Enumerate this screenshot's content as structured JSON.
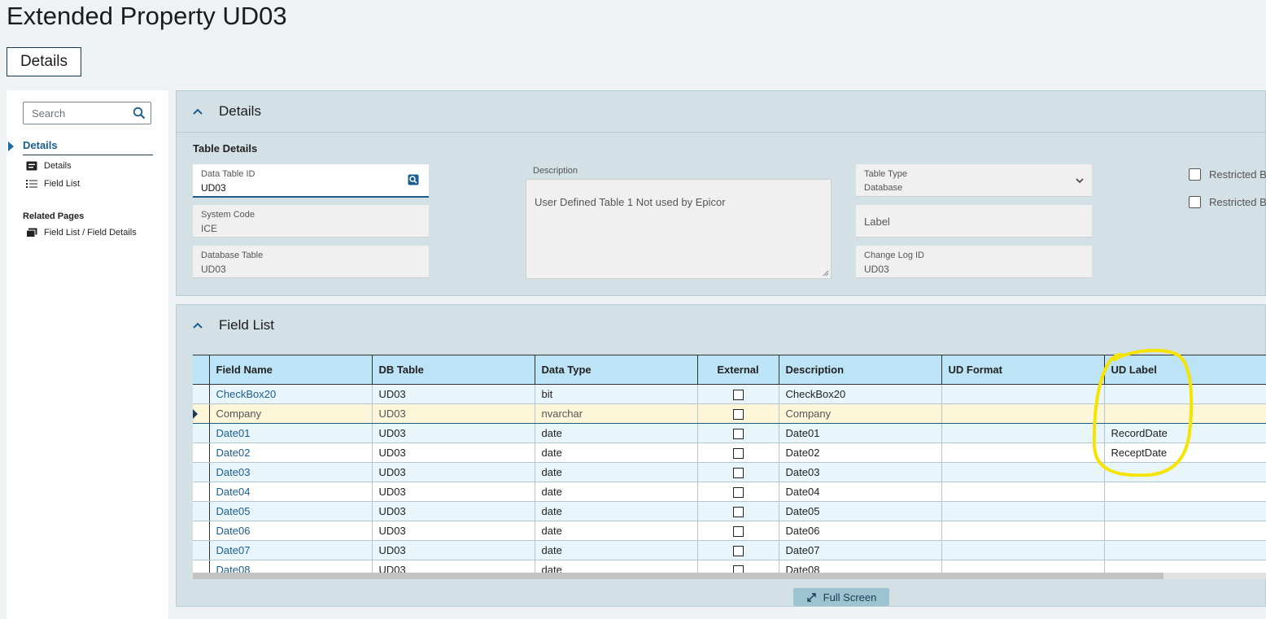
{
  "page": {
    "title": "Extended Property UD03"
  },
  "tabs": {
    "details": "Details"
  },
  "sidebar": {
    "search_placeholder": "Search",
    "nav_head": "Details",
    "items": [
      {
        "label": "Details",
        "icon": "details-card-icon"
      },
      {
        "label": "Field List",
        "icon": "list-icon"
      }
    ],
    "related_head": "Related Pages",
    "related_items": [
      {
        "label": "Field List / Field Details",
        "icon": "related-page-icon"
      }
    ]
  },
  "details_panel": {
    "title": "Details",
    "section": "Table Details",
    "data_table_id": {
      "label": "Data Table ID",
      "value": "UD03"
    },
    "system_code": {
      "label": "System Code",
      "value": "ICE"
    },
    "database_table": {
      "label": "Database Table",
      "value": "UD03"
    },
    "description": {
      "label": "Description",
      "value": "User Defined Table 1 Not used by Epicor"
    },
    "table_type": {
      "label": "Table Type",
      "value": "Database"
    },
    "label_field": {
      "label": "Label",
      "value": ""
    },
    "change_log_id": {
      "label": "Change Log ID",
      "value": "UD03"
    },
    "checkboxes": [
      {
        "label": "Restricted B"
      },
      {
        "label": "Restricted B"
      }
    ]
  },
  "field_list_panel": {
    "title": "Field List",
    "columns": [
      "Field Name",
      "DB Table",
      "Data Type",
      "External",
      "Description",
      "UD Format",
      "UD Label"
    ],
    "rows": [
      {
        "field_name": "CheckBox20",
        "db_table": "UD03",
        "data_type": "bit",
        "external": false,
        "description": "CheckBox20",
        "ud_format": "",
        "ud_label": ""
      },
      {
        "field_name": "Company",
        "db_table": "UD03",
        "data_type": "nvarchar",
        "external": false,
        "description": "Company",
        "ud_format": "",
        "ud_label": ""
      },
      {
        "field_name": "Date01",
        "db_table": "UD03",
        "data_type": "date",
        "external": false,
        "description": "Date01",
        "ud_format": "",
        "ud_label": "RecordDate"
      },
      {
        "field_name": "Date02",
        "db_table": "UD03",
        "data_type": "date",
        "external": false,
        "description": "Date02",
        "ud_format": "",
        "ud_label": "ReceptDate"
      },
      {
        "field_name": "Date03",
        "db_table": "UD03",
        "data_type": "date",
        "external": false,
        "description": "Date03",
        "ud_format": "",
        "ud_label": ""
      },
      {
        "field_name": "Date04",
        "db_table": "UD03",
        "data_type": "date",
        "external": false,
        "description": "Date04",
        "ud_format": "",
        "ud_label": ""
      },
      {
        "field_name": "Date05",
        "db_table": "UD03",
        "data_type": "date",
        "external": false,
        "description": "Date05",
        "ud_format": "",
        "ud_label": ""
      },
      {
        "field_name": "Date06",
        "db_table": "UD03",
        "data_type": "date",
        "external": false,
        "description": "Date06",
        "ud_format": "",
        "ud_label": ""
      },
      {
        "field_name": "Date07",
        "db_table": "UD03",
        "data_type": "date",
        "external": false,
        "description": "Date07",
        "ud_format": "",
        "ud_label": ""
      },
      {
        "field_name": "Date08",
        "db_table": "UD03",
        "data_type": "date",
        "external": false,
        "description": "Date08",
        "ud_format": "",
        "ud_label": ""
      }
    ],
    "selected_row": 1,
    "fullscreen_label": "Full Screen"
  },
  "colors": {
    "accent": "#1a5d8f",
    "header_bg": "#bde3f7",
    "panel_bg": "#d3e0e5",
    "highlight": "#f5e400"
  }
}
